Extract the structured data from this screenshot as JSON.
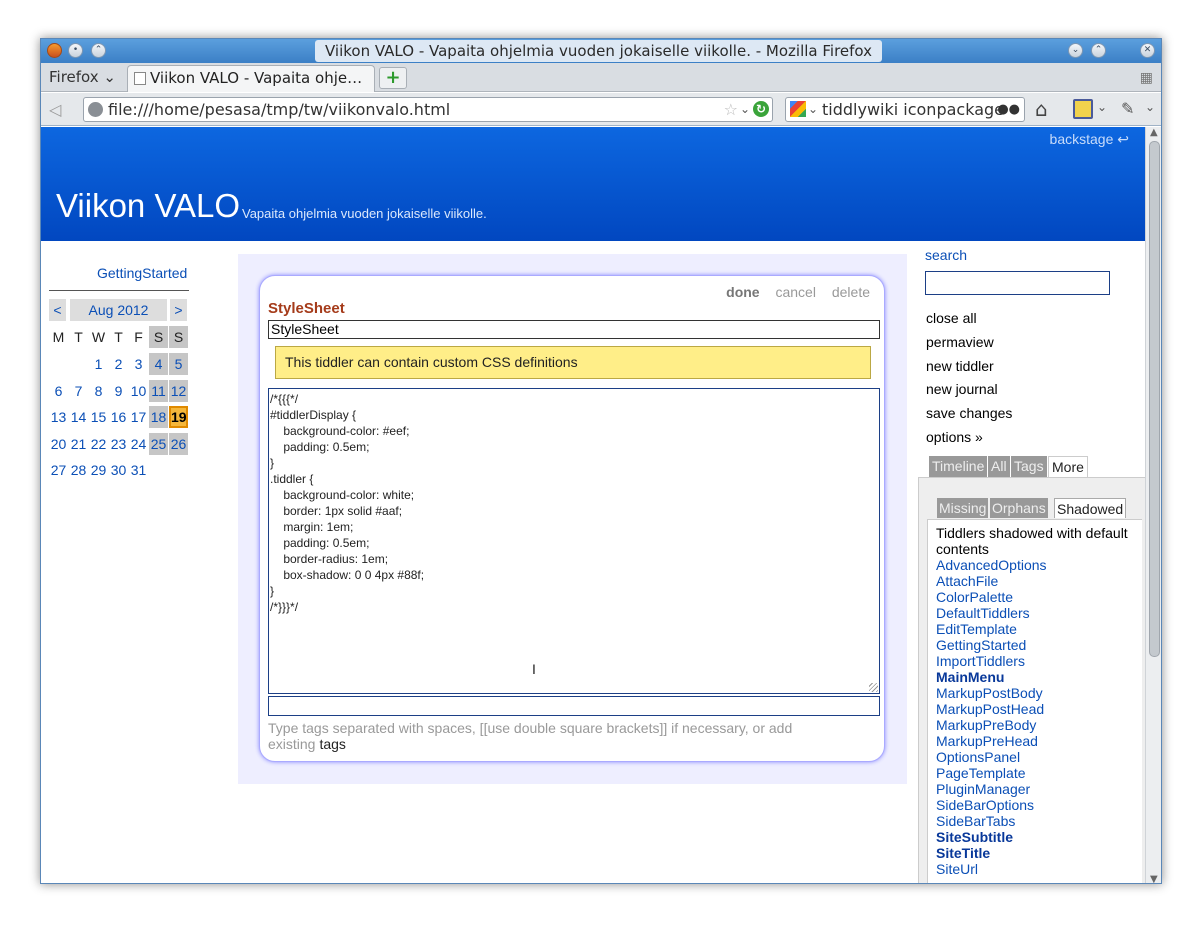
{
  "window": {
    "title": "Viikon VALO - Vapaita ohjelmia vuoden jokaiselle viikolle. - Mozilla Firefox"
  },
  "tabs": {
    "firefox_menu": "Firefox",
    "active_tab": "Viikon VALO - Vapaita ohje…"
  },
  "nav": {
    "url": "file:///home/pesasa/tmp/tw/viikonvalo.html",
    "search_value": "tiddlywiki iconpackage"
  },
  "header": {
    "backstage": "backstage ↩",
    "site_title": "Viikon VALO",
    "site_subtitle": "Vapaita ohjelmia vuoden jokaiselle viikolle."
  },
  "main_menu": {
    "link": "GettingStarted"
  },
  "calendar": {
    "prev": "<",
    "month": "Aug 2012",
    "next": ">",
    "weekdays": [
      "M",
      "T",
      "W",
      "T",
      "F",
      "S",
      "S"
    ],
    "weeks": [
      [
        "",
        "",
        "1",
        "2",
        "3",
        "4",
        "5"
      ],
      [
        "6",
        "7",
        "8",
        "9",
        "10",
        "11",
        "12"
      ],
      [
        "13",
        "14",
        "15",
        "16",
        "17",
        "18",
        "19"
      ],
      [
        "20",
        "21",
        "22",
        "23",
        "24",
        "25",
        "26"
      ],
      [
        "27",
        "28",
        "29",
        "30",
        "31",
        "",
        ""
      ]
    ],
    "today": "19"
  },
  "tiddler": {
    "commands": {
      "done": "done",
      "cancel": "cancel",
      "delete": "delete"
    },
    "title": "StyleSheet",
    "title_value": "StyleSheet",
    "annotation": "This tiddler can contain custom CSS definitions",
    "body_lines": [
      "/*{{{*/",
      "#tiddlerDisplay {",
      "    background-color: #eef;",
      "    padding: 0.5em;",
      "}",
      ".tiddler {",
      "    background-color: white;",
      "    border: 1px solid #aaf;",
      "    margin: 1em;",
      "    padding: 0.5em;",
      "    border-radius: 1em;",
      "    box-shadow: 0 0 4px #88f;",
      "}",
      "/*}}}*/"
    ],
    "tags_value": "",
    "tags_help": "Type tags separated with spaces, [[use double square brackets]] if necessary, or add existing",
    "tags_link": "tags"
  },
  "sidebar": {
    "search_label": "search",
    "search_value": "",
    "options": [
      "close all",
      "permaview",
      "new tiddler",
      "new journal",
      "save changes",
      "options »"
    ],
    "tabs": [
      "Timeline",
      "All",
      "Tags",
      "More"
    ],
    "subtabs": [
      "Missing",
      "Orphans",
      "Shadowed"
    ],
    "shadowed_heading": "Tiddlers shadowed with default contents",
    "shadowed": [
      {
        "name": "AdvancedOptions",
        "bold": false
      },
      {
        "name": "AttachFile",
        "bold": false
      },
      {
        "name": "ColorPalette",
        "bold": false
      },
      {
        "name": "DefaultTiddlers",
        "bold": false
      },
      {
        "name": "EditTemplate",
        "bold": false
      },
      {
        "name": "GettingStarted",
        "bold": false
      },
      {
        "name": "ImportTiddlers",
        "bold": false
      },
      {
        "name": "MainMenu",
        "bold": true
      },
      {
        "name": "MarkupPostBody",
        "bold": false
      },
      {
        "name": "MarkupPostHead",
        "bold": false
      },
      {
        "name": "MarkupPreBody",
        "bold": false
      },
      {
        "name": "MarkupPreHead",
        "bold": false
      },
      {
        "name": "OptionsPanel",
        "bold": false
      },
      {
        "name": "PageTemplate",
        "bold": false
      },
      {
        "name": "PluginManager",
        "bold": false
      },
      {
        "name": "SideBarOptions",
        "bold": false
      },
      {
        "name": "SideBarTabs",
        "bold": false
      },
      {
        "name": "SiteSubtitle",
        "bold": true
      },
      {
        "name": "SiteTitle",
        "bold": true
      },
      {
        "name": "SiteUrl",
        "bold": false
      }
    ]
  },
  "colors": {
    "header": "#0147c0",
    "story_bg": "#eeeeff",
    "link": "#0b4fb6",
    "tiddler_title": "#a53b1a",
    "annotation_bg": "#ffee88"
  }
}
